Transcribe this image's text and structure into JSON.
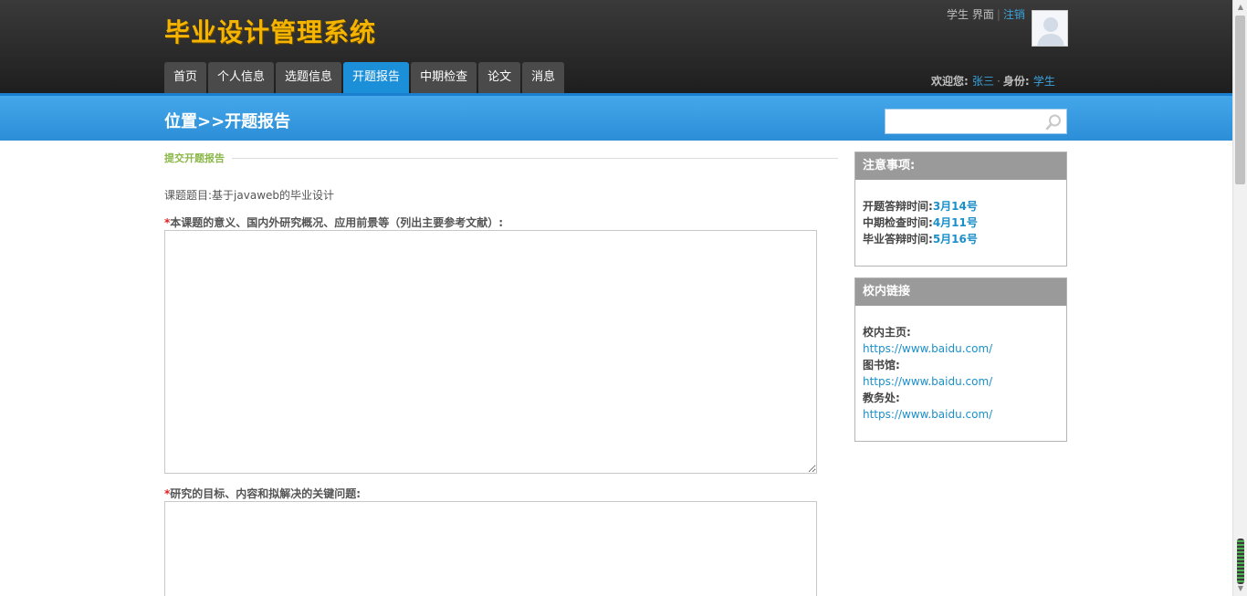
{
  "header": {
    "site_title": "毕业设计管理系统",
    "role_label": "学生 界面",
    "logout_label": "注销",
    "welcome_label": "欢迎您:",
    "user_name": "张三",
    "identity_label": "身份:",
    "identity_value": "学生"
  },
  "nav": {
    "items": [
      {
        "label": "首页"
      },
      {
        "label": "个人信息"
      },
      {
        "label": "选题信息"
      },
      {
        "label": "开题报告",
        "active": true
      },
      {
        "label": "中期检查"
      },
      {
        "label": "论文"
      },
      {
        "label": "消息"
      }
    ]
  },
  "location": {
    "title": "位置>>开题报告",
    "search_value": ""
  },
  "main": {
    "section_title": "提交开题报告",
    "topic_label": "课题题目:",
    "topic_value": "基于javaweb的毕业设计",
    "required_mark": "*",
    "field1_label": "本课题的意义、国内外研究概况、应用前景等（列出主要参考文献）:",
    "field1_value": "",
    "field2_label": "研究的目标、内容和拟解决的关键问题:",
    "field2_value": ""
  },
  "sidebar": {
    "notice": {
      "title": "注意事项:",
      "items": [
        {
          "label": "开题答辩时间:",
          "value": "3月14号"
        },
        {
          "label": "中期检查时间:",
          "value": "4月11号"
        },
        {
          "label": "毕业答辩时间:",
          "value": "5月16号"
        }
      ]
    },
    "links": {
      "title": "校内链接",
      "items": [
        {
          "label": "校内主页:",
          "url": "https://www.baidu.com/"
        },
        {
          "label": "图书馆:",
          "url": "https://www.baidu.com/"
        },
        {
          "label": "教务处:",
          "url": "https://www.baidu.com/"
        }
      ]
    }
  },
  "colors": {
    "title": "#f5b400",
    "nav_active": "#1b8fd8",
    "link": "#1a8fc9",
    "section_green": "#8cb84a"
  },
  "icons": [
    "user-avatar-icon",
    "search-icon"
  ]
}
